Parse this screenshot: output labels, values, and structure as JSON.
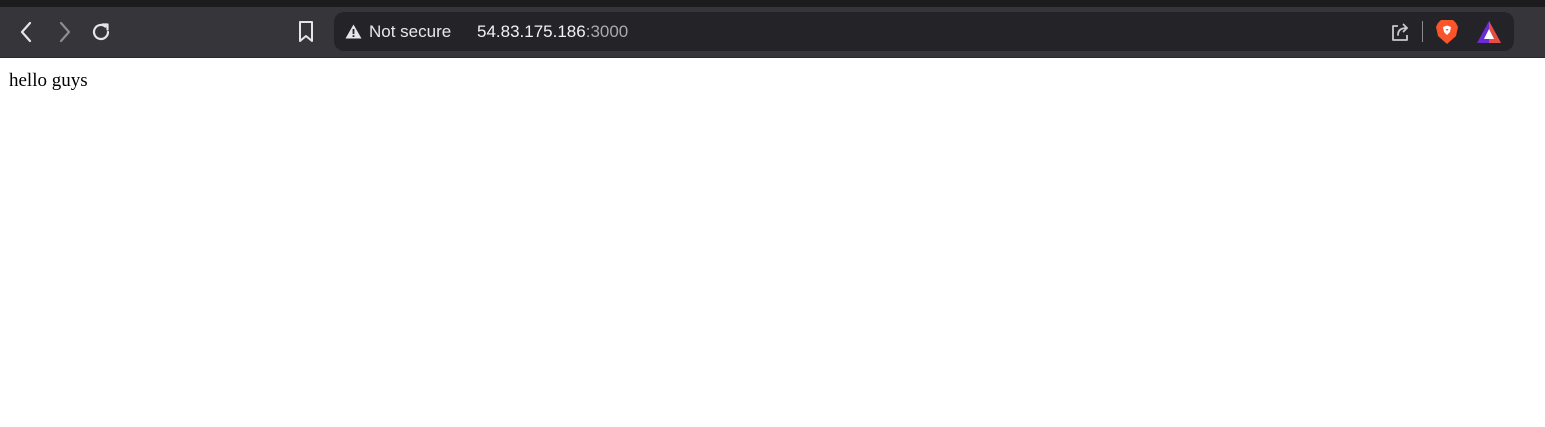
{
  "browser": {
    "toolbar": {
      "back_icon": "chevron-left-icon",
      "forward_icon": "chevron-right-icon",
      "reload_icon": "reload-icon",
      "bookmark_icon": "bookmark-icon"
    },
    "omnibox": {
      "security_icon": "warning-triangle-icon",
      "security_label": "Not secure",
      "url_host": "54.83.175.186",
      "url_port": ":3000",
      "share_icon": "share-icon",
      "shield_icon": "brave-shield-icon",
      "rewards_icon": "brave-rewards-icon"
    },
    "colors": {
      "toolbar_bg": "#36363a",
      "omnibox_bg": "#242428",
      "brave_orange": "#fb542b",
      "rewards_purple": "#6a2bd5"
    }
  },
  "page": {
    "text": "hello guys"
  }
}
